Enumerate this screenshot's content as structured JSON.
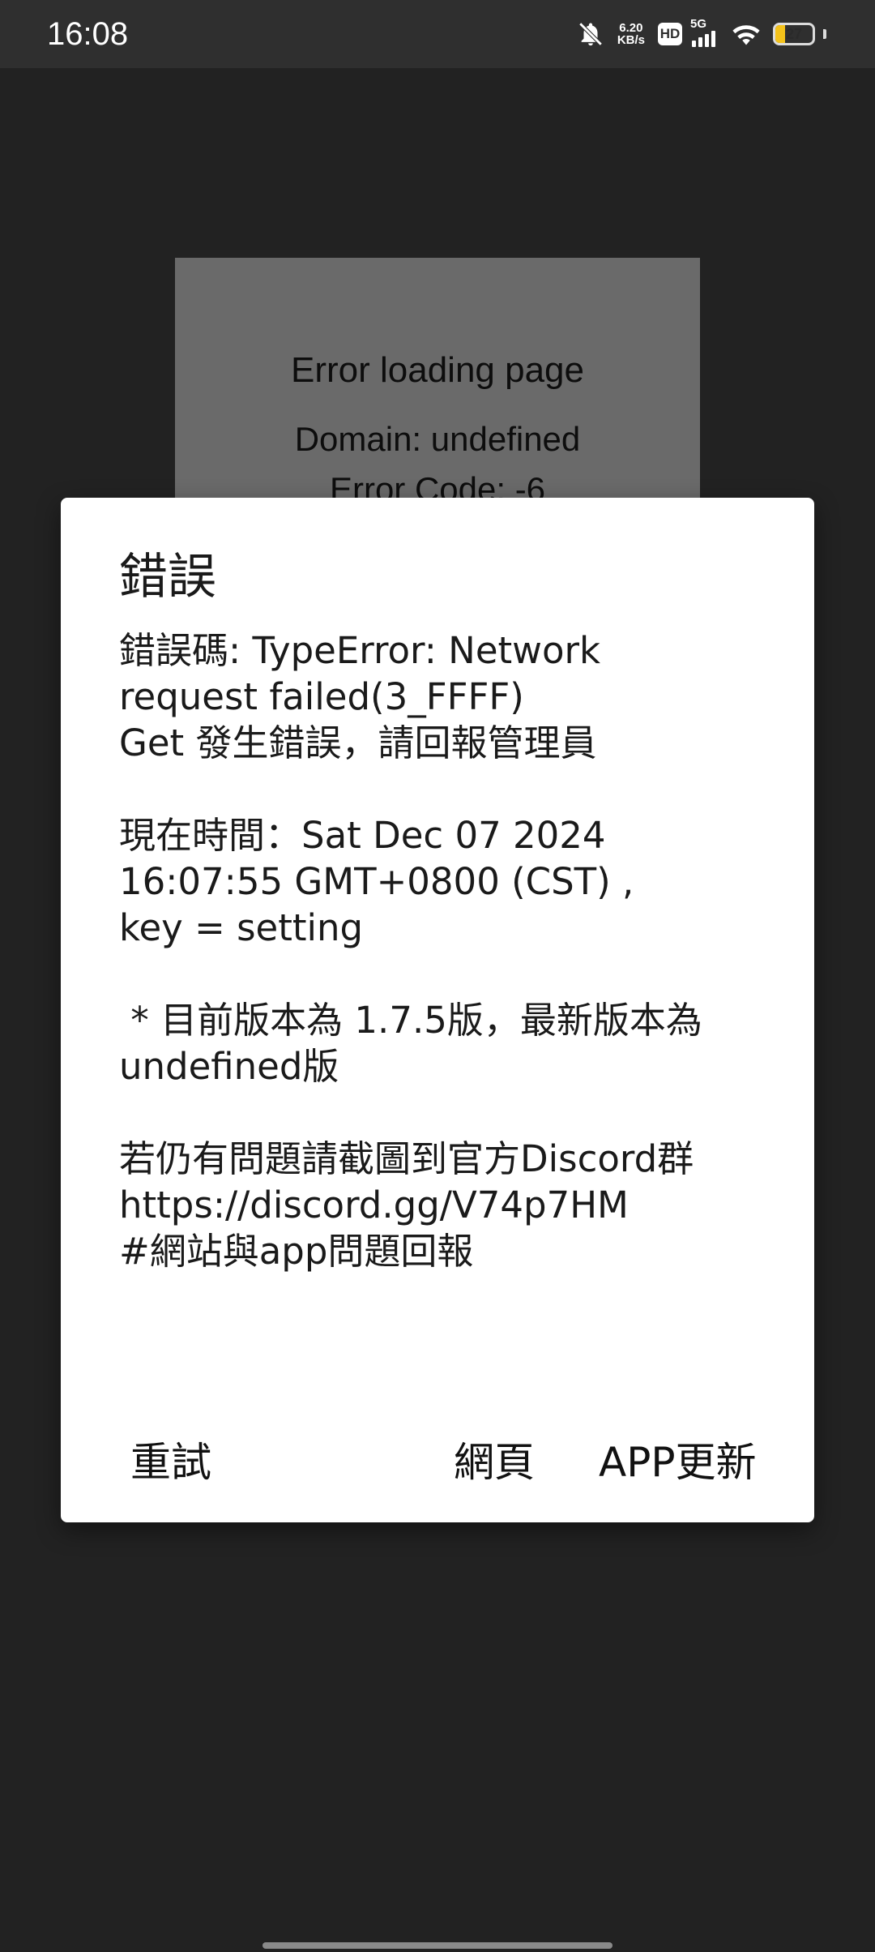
{
  "status_bar": {
    "time": "16:08",
    "net_speed_value": "6.20",
    "net_speed_unit": "KB/s",
    "hd_label": "HD",
    "network_label": "5G",
    "battery_level": "27",
    "battery_color": "#f4c21a",
    "icons": [
      "bell-off-icon",
      "hd-icon",
      "cellular-signal-icon",
      "wifi-icon",
      "battery-icon"
    ]
  },
  "webview": {
    "title": "Error loading page",
    "domain_line": "Domain: undefined",
    "error_code_line": "Error Code: -6"
  },
  "dialog": {
    "title": "錯誤",
    "message_lines": [
      "錯誤碼: TypeError: Network",
      "request failed(3_FFFF)",
      "Get 發生錯誤，請回報管理員",
      "",
      "現在時間：Sat Dec 07 2024",
      "16:07:55 GMT+0800 (CST) ,",
      "key = setting",
      "",
      " * 目前版本為 1.7.5版，最新版本為",
      "undefined版",
      "",
      "若仍有問題請截圖到官方Discord群",
      "https://discord.gg/V74p7HM",
      "#網站與app問題回報"
    ],
    "buttons": {
      "retry": "重試",
      "web": "網頁",
      "app_update": "APP更新"
    }
  }
}
